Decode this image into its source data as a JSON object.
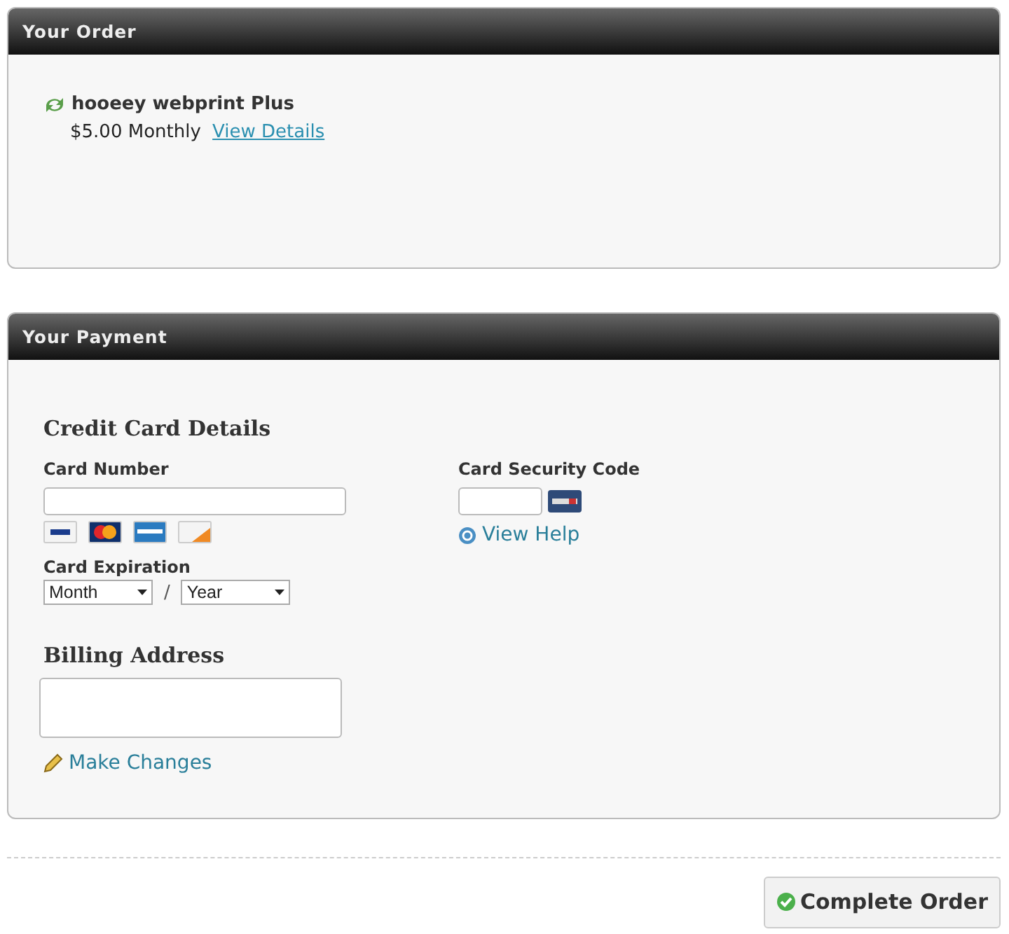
{
  "order": {
    "title": "Your Order",
    "product": "hooeey webprint Plus",
    "price": "$5.00 Monthly",
    "details_link": "View Details"
  },
  "payment": {
    "title": "Your Payment",
    "section_title": "Credit Card Details",
    "card_number": {
      "label": "Card Number"
    },
    "security_code": {
      "label": "Card Security Code",
      "help_link": "View Help"
    },
    "expiration": {
      "label": "Card Expiration",
      "month": "Month",
      "separator": "/",
      "year": "Year"
    },
    "billing": {
      "title": "Billing Address",
      "change_link": "Make Changes"
    }
  },
  "submit": {
    "label": "Complete Order"
  }
}
